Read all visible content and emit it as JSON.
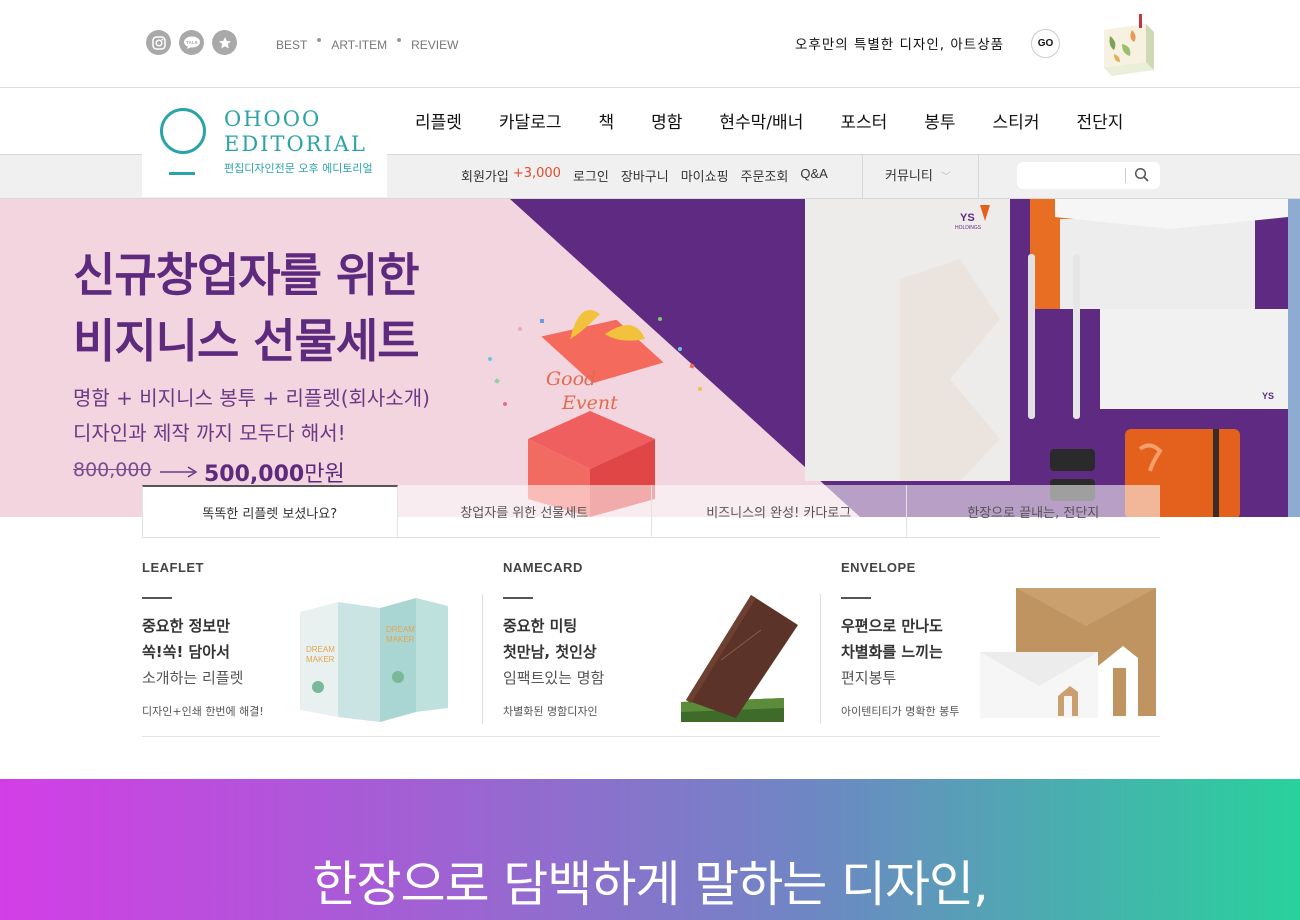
{
  "header": {
    "social_icons": [
      "instagram-icon",
      "talk-icon",
      "star-icon"
    ],
    "talk_label": "TALK",
    "links": [
      "BEST",
      "ART-ITEM",
      "REVIEW"
    ],
    "promo": "오후만의 특별한 디자인, 아트상품",
    "go_label": "GO"
  },
  "logo": {
    "line1": "OHOOO",
    "line2": "EDITORIAL",
    "sub": "편집디자인전문 오후 에디토리얼"
  },
  "nav": {
    "items": [
      "리플렛",
      "카달로그",
      "책",
      "명함",
      "현수막/배너",
      "포스터",
      "봉투",
      "스티커",
      "전단지"
    ]
  },
  "subnav": {
    "signup": "회원가입",
    "signup_points": "+3,000",
    "login": "로그인",
    "cart": "장바구니",
    "mypage": "마이쇼핑",
    "orders": "주문조회",
    "qa": "Q&A",
    "community": "커뮤니티",
    "search_placeholder": ""
  },
  "hero": {
    "title_line1": "신규창업자를 위한",
    "title_line2": "비지니스 선물세트",
    "sub_line1": "명함 + 비지니스 봉투 + 리플렛(회사소개)",
    "sub_line2": "디자인과 제작 까지 모두다 해서!",
    "old_price": "800,000",
    "new_price": "500,000",
    "price_unit": "만원",
    "gift_text1": "Good",
    "gift_text2": "Event",
    "brand_mark": "YS",
    "brand_sub": "HOLDINGS",
    "colors": {
      "pink": "#f2d5de",
      "purple": "#5f2a82",
      "orange": "#e3611c"
    }
  },
  "tabs": [
    {
      "label": "똑똑한 리플렛 보셨나요?",
      "active": true
    },
    {
      "label": "창업자를 위한 선물세트",
      "active": false
    },
    {
      "label": "비즈니스의 완성! 카다로그",
      "active": false
    },
    {
      "label": "한장으로 끝내는, 전단지",
      "active": false
    }
  ],
  "products": [
    {
      "title": "LEAFLET",
      "h1": "중요한 정보만",
      "h2": "쏙!쏙! 담아서",
      "light": "소개하는 리플렛",
      "note": "디자인+인쇄 한번에 해결!",
      "image_text1": "DREAM",
      "image_text2": "MAKER"
    },
    {
      "title": "NAMECARD",
      "h1": "중요한 미팅",
      "h2": "첫만남, 첫인상",
      "light": "임팩트있는 명함",
      "note": "차별화된 명함디자인"
    },
    {
      "title": "ENVELOPE",
      "h1": "우편으로 만나도",
      "h2": "차별화를 느끼는",
      "light": "편지봉투",
      "note": "아이텐티티가 명확한 봉투"
    }
  ],
  "banner": {
    "text": "한장으로 담백하게 말하는 디자인,"
  }
}
